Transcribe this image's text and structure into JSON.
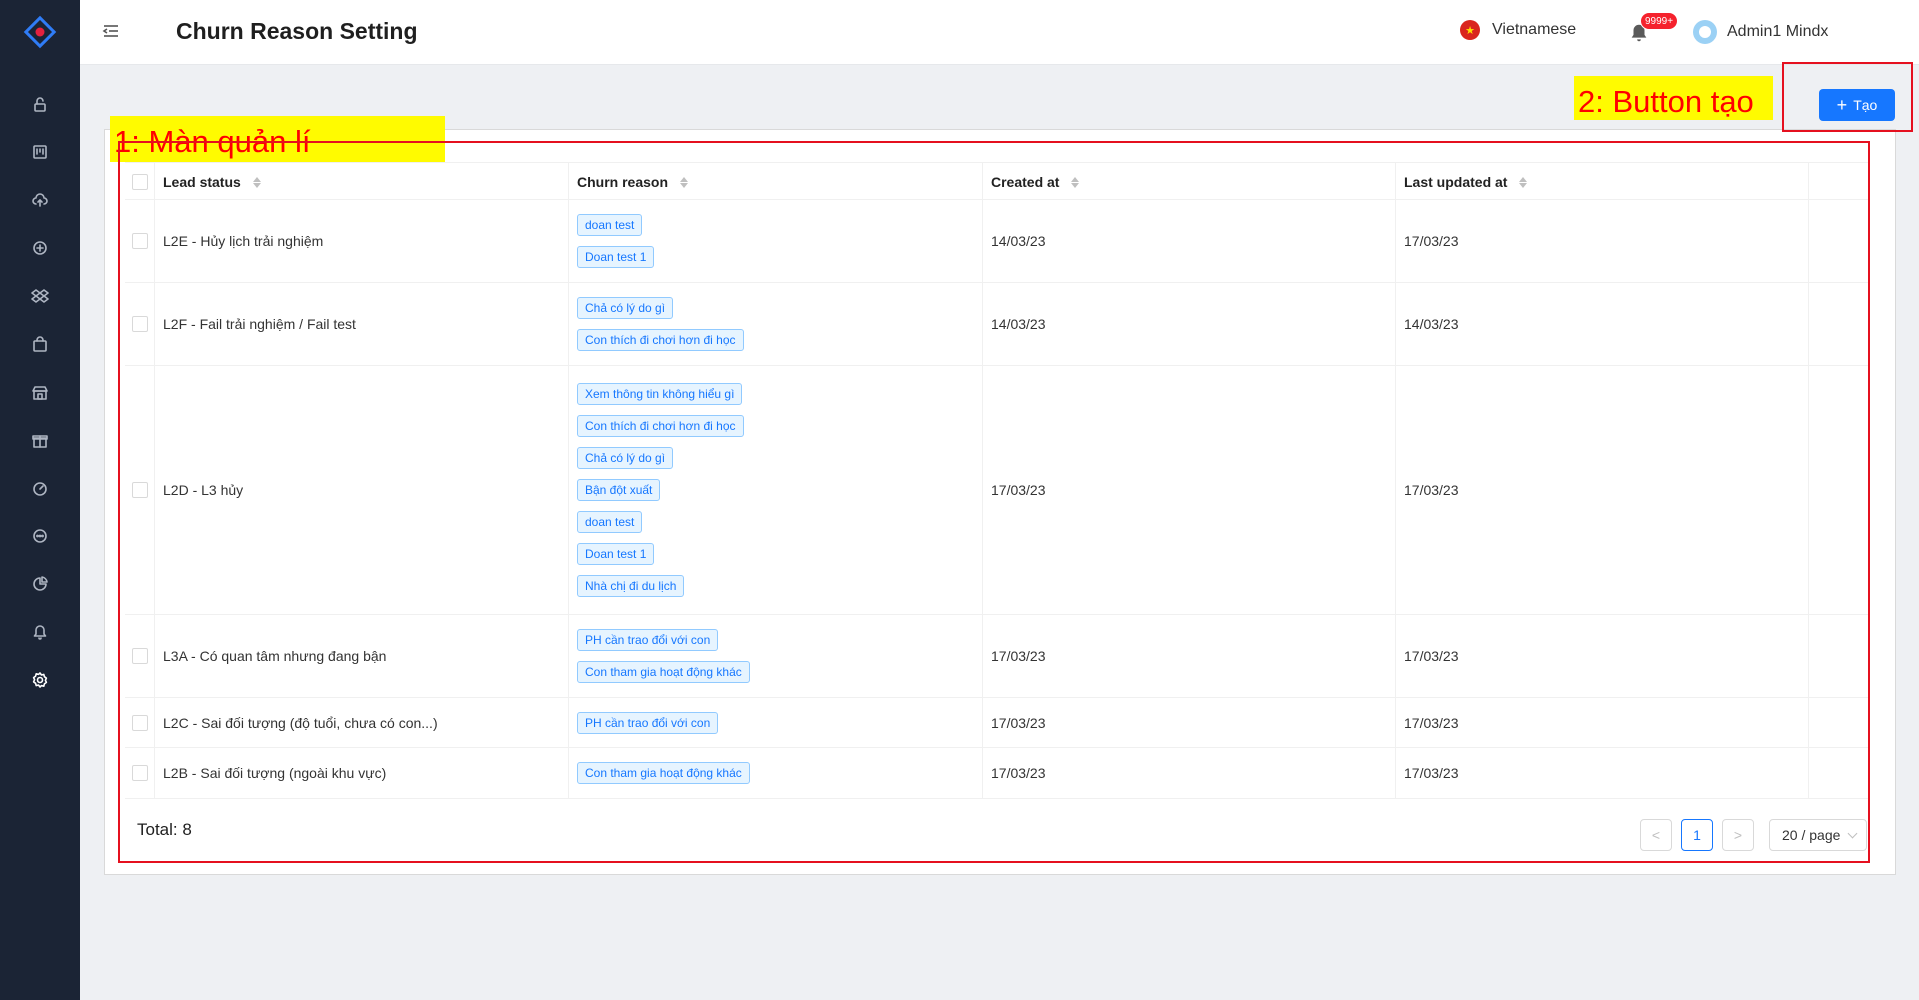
{
  "header": {
    "title": "Churn Reason Setting",
    "language": "Vietnamese",
    "notification_count": "9999+",
    "user_name": "Admin1 Mindx"
  },
  "annotations": {
    "area_1": "1: Màn quản lí",
    "area_2": "2: Button tạo",
    "color": "#ff0000",
    "highlight": "#fffb00"
  },
  "sidebar": {
    "items": [
      {
        "icon": "unlock-icon"
      },
      {
        "icon": "board-icon"
      },
      {
        "icon": "upload-cloud-icon"
      },
      {
        "icon": "plus-circle-icon"
      },
      {
        "icon": "dropbox-icon"
      },
      {
        "icon": "shopping-bag-icon"
      },
      {
        "icon": "shop-icon"
      },
      {
        "icon": "gift-icon"
      },
      {
        "icon": "dashboard-icon"
      },
      {
        "icon": "message-icon"
      },
      {
        "icon": "pie-chart-icon"
      },
      {
        "icon": "bell-icon"
      },
      {
        "icon": "setting-icon",
        "active": true
      }
    ]
  },
  "toolbar": {
    "create_label": "Tạo",
    "accent": "#1677ff"
  },
  "table": {
    "columns": [
      "Lead status",
      "Churn reason",
      "Created at",
      "Last updated at"
    ],
    "rows": [
      {
        "status": "L2E - Hủy lịch trải nghiệm",
        "reasons": [
          "doan test",
          "Doan test 1"
        ],
        "created": "14/03/23",
        "updated": "17/03/23"
      },
      {
        "status": "L2F - Fail trải nghiệm / Fail test",
        "reasons": [
          "Chả có lý do gì",
          "Con thích đi chơi hơn đi học"
        ],
        "created": "14/03/23",
        "updated": "14/03/23"
      },
      {
        "status": "L2D - L3 hủy",
        "reasons": [
          "Xem thông tin không hiểu gì",
          "Con thích đi chơi hơn đi học",
          "Chả có lý do gì",
          "Bận đột xuất",
          "doan test",
          "Doan test 1",
          "Nhà chị đi du lịch"
        ],
        "created": "17/03/23",
        "updated": "17/03/23"
      },
      {
        "status": "L3A - Có quan tâm nhưng đang bận",
        "reasons": [
          "PH cần trao đổi với con",
          "Con tham gia hoạt động khác"
        ],
        "created": "17/03/23",
        "updated": "17/03/23"
      },
      {
        "status": "L2C - Sai đối tượng (độ tuổi, chưa có con...)",
        "reasons": [
          "PH cần trao đổi với con"
        ],
        "created": "17/03/23",
        "updated": "17/03/23"
      },
      {
        "status": "L2B - Sai đối tượng (ngoài khu vực)",
        "reasons": [
          "Con tham gia hoạt động khác"
        ],
        "created": "17/03/23",
        "updated": "17/03/23"
      }
    ]
  },
  "footer": {
    "total": "Total: 8",
    "current_page": "1",
    "page_size": "20 / page",
    "prev": "<",
    "next": ">"
  }
}
